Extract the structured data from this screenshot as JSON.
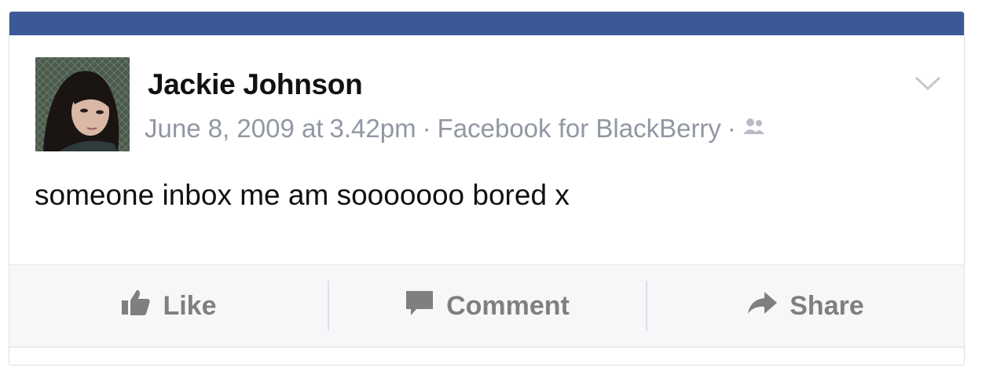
{
  "post": {
    "author": "Jackie Johnson",
    "date": "June 8, 2009 at",
    "time": "3.42pm",
    "separator": "·",
    "source": "Facebook for BlackBerry",
    "audience_icon": "friends-icon",
    "text": "someone inbox me am sooooooo bored x"
  },
  "actions": {
    "like": "Like",
    "comment": "Comment",
    "share": "Share"
  },
  "colors": {
    "brand": "#3b5998",
    "meta_text": "#9197a3",
    "action_text": "#7f7f7f"
  }
}
